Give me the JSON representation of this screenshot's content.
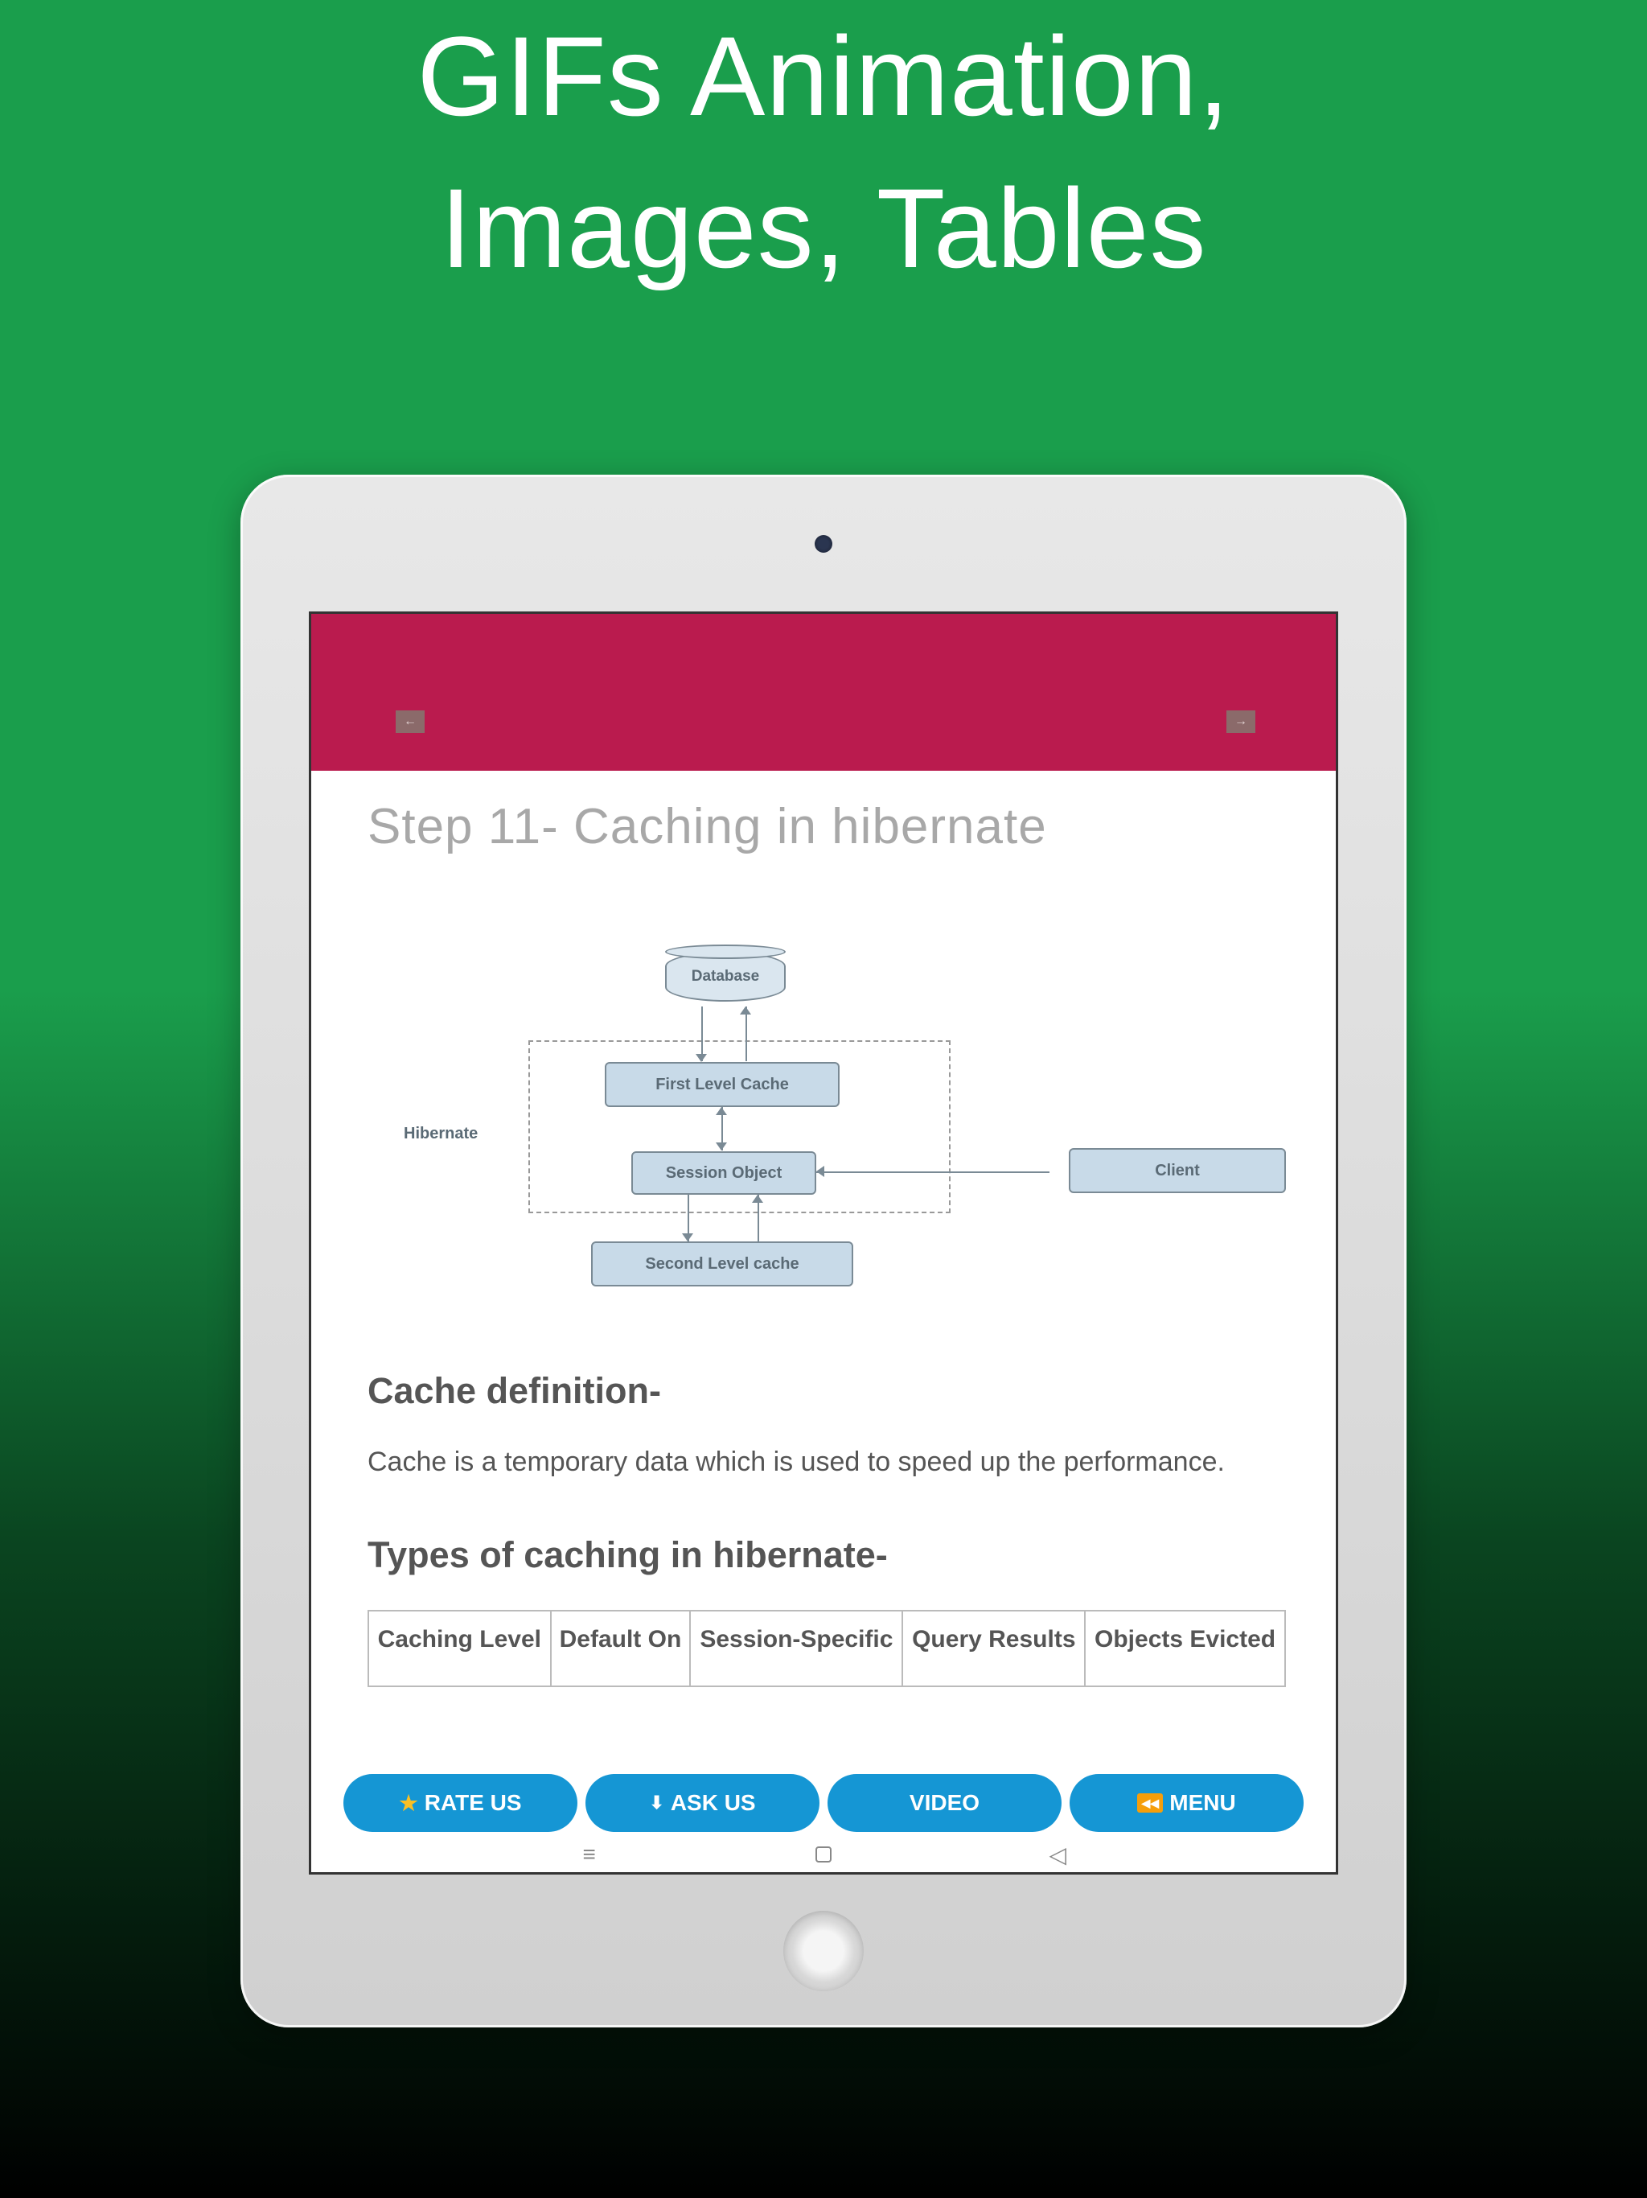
{
  "promo": {
    "title": "GIFs Animation,\nImages, Tables"
  },
  "app": {
    "page_title": "Step 11- Caching in hibernate",
    "diagram": {
      "database": "Database",
      "first_level": "First Level Cache",
      "session_object": "Session Object",
      "second_level": "Second Level cache",
      "client": "Client",
      "hibernate_label": "Hibernate"
    },
    "sections": {
      "definition_heading": "Cache definition-",
      "definition_body": "Cache is a temporary data which is used to speed up the performance.",
      "types_heading": "Types of caching in hibernate-"
    },
    "table": {
      "headers": [
        "Caching Level",
        "Default On",
        "Session-Specific",
        "Query Results",
        "Objects Evicted"
      ]
    },
    "bottom_buttons": {
      "rate": "RATE US",
      "ask": "ASK US",
      "video": "VIDEO",
      "menu": "MENU"
    }
  }
}
